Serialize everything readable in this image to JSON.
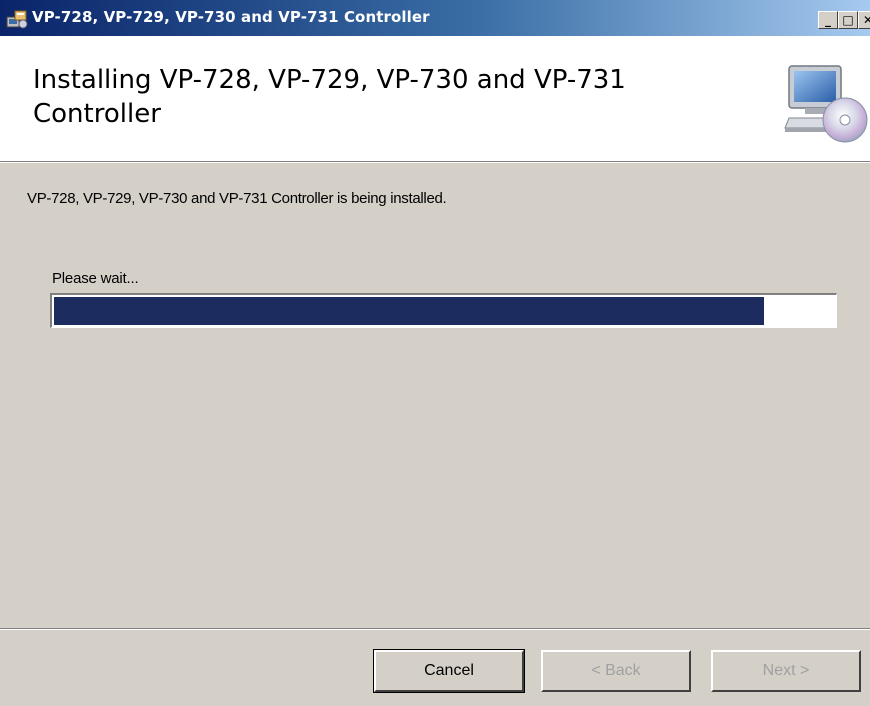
{
  "window": {
    "title": "VP-728, VP-729, VP-730 and VP-731 Controller",
    "icon": "installer-icon",
    "controls": {
      "minimize": "_",
      "maximize": "□",
      "close": "✕"
    }
  },
  "banner": {
    "title": "Installing VP-728, VP-729, VP-730 and VP-731 Controller",
    "icon": "computer-cd-icon"
  },
  "body": {
    "status": "VP-728, VP-729, VP-730 and VP-731 Controller is being installed.",
    "wait_label": "Please wait...",
    "progress_fraction": 0.91,
    "progress_color": "#1c2c5e"
  },
  "buttons": {
    "cancel": "Cancel",
    "back": "< Back",
    "next": "Next >"
  },
  "colors": {
    "titlebar_start": "#0a246a",
    "titlebar_end": "#a6caf0",
    "dialog_bg": "#d4d0c8",
    "disabled_text": "#a0a0a0"
  }
}
